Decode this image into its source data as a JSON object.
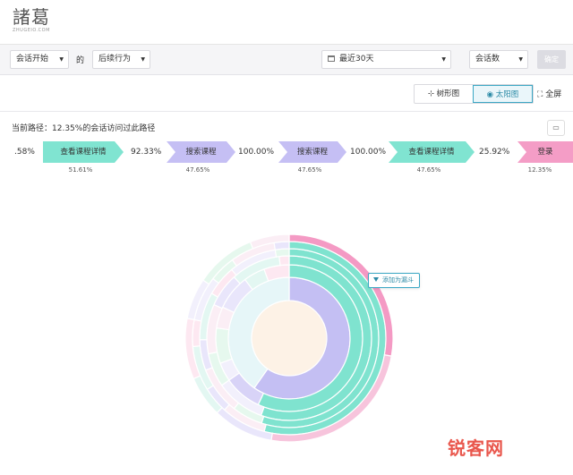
{
  "brand": {
    "logo_text": "諸葛",
    "logo_sub": "ZHUGEIO.COM"
  },
  "filters": {
    "start_event": "会话开始",
    "connector": "的",
    "behavior": "后续行为",
    "date_range": "最近30天",
    "metric": "会话数",
    "confirm_label": "确定"
  },
  "view": {
    "tree_label": "树形图",
    "sunburst_label": "太阳图",
    "fullscreen_label": "全屏"
  },
  "path": {
    "current_label": "当前路径：12.35%的会话访问过此路径",
    "lead_pct": ".58%",
    "steps": [
      {
        "label": "查看课程详情",
        "pct_after": "92.33%",
        "sub": "51.61%"
      },
      {
        "label": "搜索课程",
        "pct_after": "100.00%",
        "sub": "47.65%"
      },
      {
        "label": "搜索课程",
        "pct_after": "100.00%",
        "sub": "47.65%"
      },
      {
        "label": "查看课程详情",
        "pct_after": "25.92%",
        "sub": "47.65%"
      },
      {
        "label": "登录",
        "pct_after": "",
        "sub": "12.35%"
      }
    ]
  },
  "tooltip": {
    "label": "添加为漏斗"
  },
  "watermark": "锐客网",
  "colors": {
    "accent": "#3ba7c4",
    "teal": "#7fe3cf",
    "lavender": "#c4bff3",
    "pink": "#f49ac4",
    "center": "#fdf2e6"
  },
  "icons": {
    "caret": "caret-down-icon",
    "calendar": "calendar-icon",
    "tree": "tree-icon",
    "sunburst": "sunburst-icon",
    "fullscreen": "fullscreen-icon",
    "comment": "comment-icon",
    "funnel": "funnel-icon"
  }
}
